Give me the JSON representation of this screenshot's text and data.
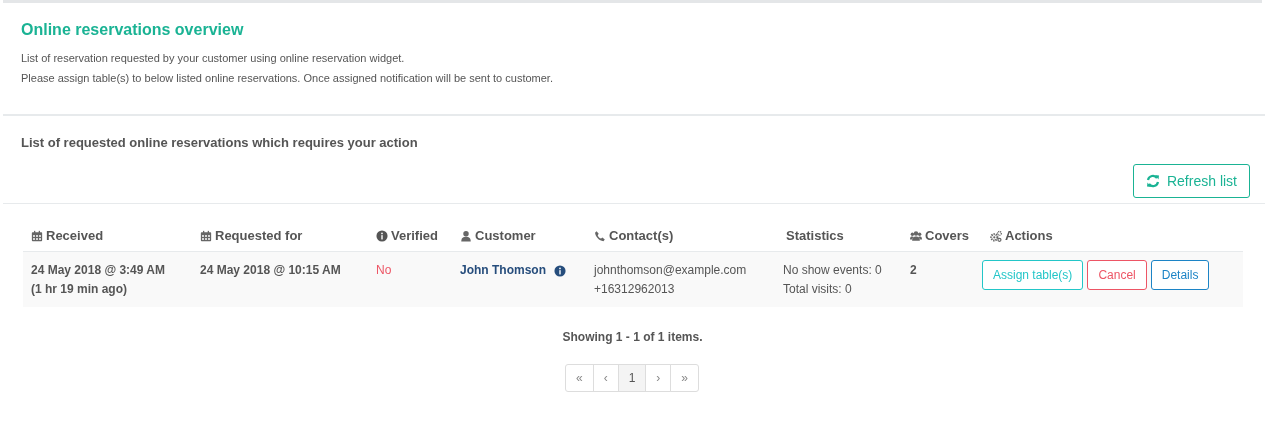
{
  "header": {
    "title": "Online reservations overview",
    "lines": [
      "List of reservation requested by your customer using online reservation widget.",
      "Please assign table(s) to below listed online reservations. Once assigned notification will be sent to customer."
    ]
  },
  "section": {
    "title": "List of requested online reservations which requires your action",
    "refresh_button": "Refresh list"
  },
  "table": {
    "columns": [
      {
        "label": "Received",
        "kind": "calendar"
      },
      {
        "label": "Requested for",
        "kind": "calendar"
      },
      {
        "label": "Verified",
        "kind": "info"
      },
      {
        "label": "Customer",
        "kind": "user"
      },
      {
        "label": "Contact(s)",
        "kind": "phone"
      },
      {
        "label": "Statistics",
        "kind": "plain"
      },
      {
        "label": "Covers",
        "kind": "users"
      },
      {
        "label": "Actions",
        "kind": "cogs"
      }
    ],
    "rows": [
      {
        "received": [
          "24 May 2018 @ 3:49 AM",
          "(1 hr 19 min ago)"
        ],
        "requested_for": "24 May 2018 @ 10:15 AM",
        "verified": false,
        "verified_text": "No",
        "customer": "John Thomson",
        "contacts": [
          "johnthomson@example.com",
          "+16312962013"
        ],
        "statistics": [
          "No show events: 0",
          "Total visits: 0"
        ],
        "covers": "2",
        "actions": [
          {
            "label": "Assign table(s)",
            "kind": "info"
          },
          {
            "label": "Cancel",
            "kind": "danger"
          },
          {
            "label": "Details",
            "kind": "primary"
          }
        ]
      }
    ]
  },
  "summary": "Showing 1 - 1 of 1 items.",
  "pagination": [
    {
      "label": "«",
      "selected": false
    },
    {
      "label": "‹",
      "selected": false
    },
    {
      "label": "1",
      "selected": true
    },
    {
      "label": "›",
      "selected": false
    },
    {
      "label": "»",
      "selected": false
    }
  ]
}
